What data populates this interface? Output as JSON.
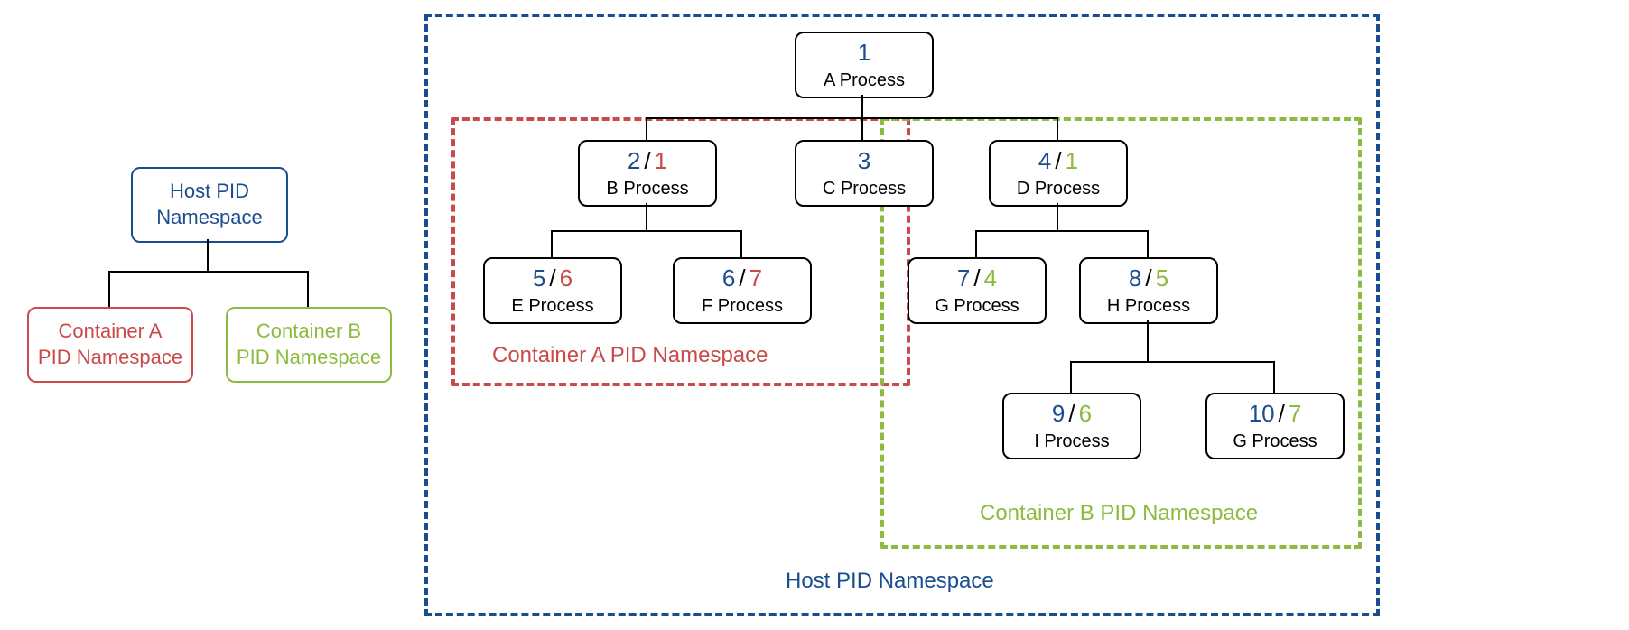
{
  "legend": {
    "host": {
      "line1": "Host PID",
      "line2": "Namespace"
    },
    "containerA": {
      "line1": "Container A",
      "line2": "PID Namespace"
    },
    "containerB": {
      "line1": "Container B",
      "line2": "PID Namespace"
    }
  },
  "processes": {
    "A": {
      "hostPid": "1",
      "name": "A Process"
    },
    "B": {
      "hostPid": "2",
      "altPid": "1",
      "name": "B Process"
    },
    "C": {
      "hostPid": "3",
      "name": "C Process"
    },
    "D": {
      "hostPid": "4",
      "altPid": "1",
      "name": "D Process"
    },
    "E": {
      "hostPid": "5",
      "altPid": "6",
      "name": "E Process"
    },
    "F": {
      "hostPid": "6",
      "altPid": "7",
      "name": "F Process"
    },
    "G": {
      "hostPid": "7",
      "altPid": "4",
      "name": "G Process"
    },
    "H": {
      "hostPid": "8",
      "altPid": "5",
      "name": "H Process"
    },
    "I": {
      "hostPid": "9",
      "altPid": "6",
      "name": "I Process"
    },
    "G2": {
      "hostPid": "10",
      "altPid": "7",
      "name": "G Process"
    }
  },
  "labels": {
    "containerA": "Container A PID Namespace",
    "containerB": "Container B PID Namespace",
    "host": "Host PID Namespace"
  },
  "slash": "/"
}
